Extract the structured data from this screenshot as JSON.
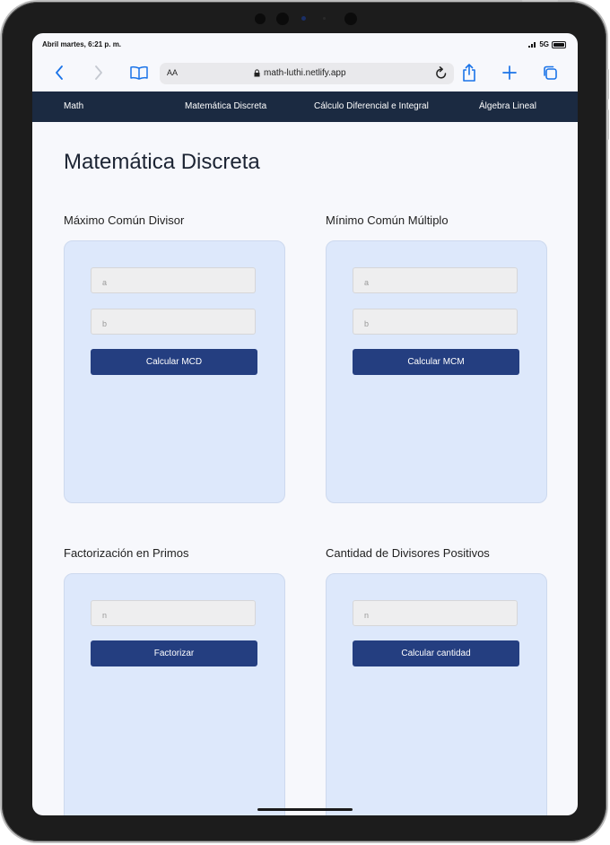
{
  "status": {
    "time": "Abril martes, 6:21 p. m.",
    "network": "5G"
  },
  "browser": {
    "text_size_label": "AA",
    "url": "math-luthi.netlify.app"
  },
  "nav": {
    "brand": "Math",
    "links": [
      "Matemática Discreta",
      "Cálculo Diferencial e Integral",
      "Álgebra Lineal"
    ]
  },
  "page": {
    "title": "Matemática Discreta"
  },
  "sections": [
    {
      "title": "Máximo Común Divisor",
      "inputs": [
        "a",
        "b"
      ],
      "button": "Calcular MCD"
    },
    {
      "title": "Mínimo Común Múltiplo",
      "inputs": [
        "a",
        "b"
      ],
      "button": "Calcular MCM"
    },
    {
      "title": "Factorización en Primos",
      "inputs": [
        "n"
      ],
      "button": "Factorizar"
    },
    {
      "title": "Cantidad de Divisores Positivos",
      "inputs": [
        "n"
      ],
      "button": "Calcular cantidad"
    }
  ],
  "icons": [
    "back-icon",
    "forward-icon",
    "bookmarks-icon",
    "lock-icon",
    "reload-icon",
    "share-icon",
    "new-tab-icon",
    "tabs-icon"
  ],
  "colors": {
    "nav_bg": "#1b2a41",
    "button_bg": "#243e80",
    "card_bg": "#dde8fb",
    "link": "#1a73e8"
  }
}
